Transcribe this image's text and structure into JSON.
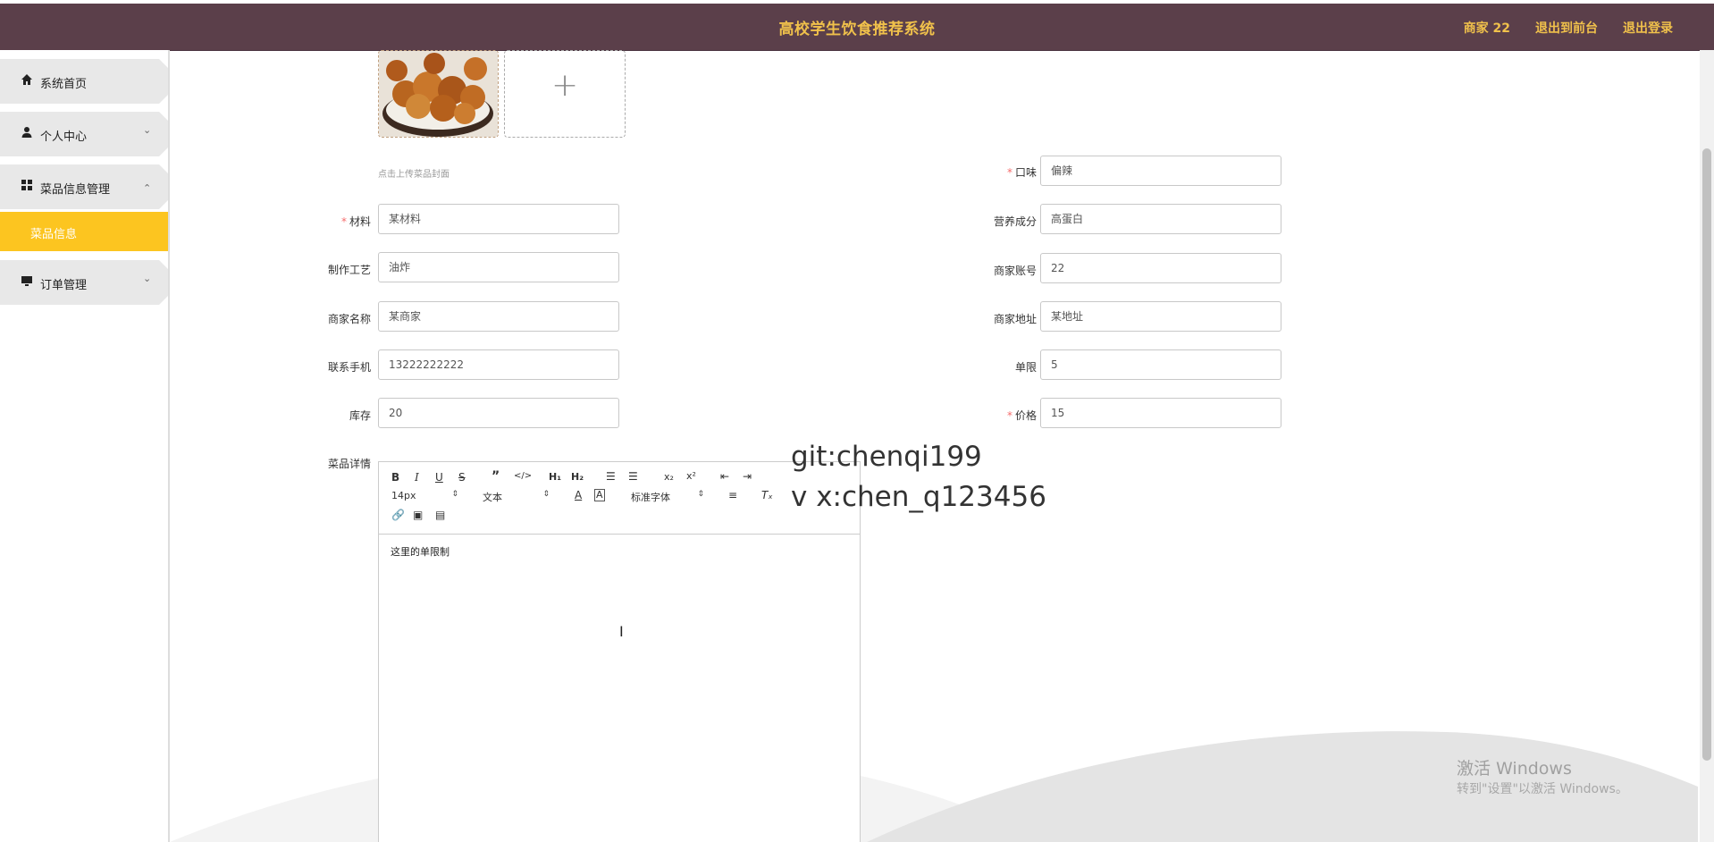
{
  "header": {
    "title": "高校学生饮食推荐系统",
    "links": [
      "商家 22",
      "退出到前台",
      "退出登录"
    ]
  },
  "sidebar": {
    "items": [
      {
        "label": "系统首页",
        "icon": "home-icon"
      },
      {
        "label": "个人中心",
        "icon": "user-icon"
      },
      {
        "label": "菜品信息管理",
        "icon": "grid-icon"
      },
      {
        "label": "订单管理",
        "icon": "monitor-icon"
      }
    ],
    "active_sub": "菜品信息"
  },
  "upload": {
    "tip": "点击上传菜品封面"
  },
  "form": {
    "taste_label": "口味",
    "taste_value": "偏辣",
    "material_label": "材料",
    "material_value": "某材料",
    "nutrition_label": "营养成分",
    "nutrition_value": "高蛋白",
    "craft_label": "制作工艺",
    "craft_value": "油炸",
    "merchant_account_label": "商家账号",
    "merchant_account_value": "22",
    "merchant_name_label": "商家名称",
    "merchant_name_value": "某商家",
    "merchant_address_label": "商家地址",
    "merchant_address_value": "某地址",
    "phone_label": "联系手机",
    "phone_value": "13222222222",
    "limit_label": "单限",
    "limit_value": "5",
    "stock_label": "库存",
    "stock_value": "20",
    "price_label": "价格",
    "price_value": "15",
    "detail_label": "菜品详情"
  },
  "editor": {
    "font_size": "14px",
    "text_type": "文本",
    "font_family": "标准字体",
    "content": "这里的单限制"
  },
  "overlay": {
    "line1": "git:chenqi199",
    "line2": "v x:chen_q123456"
  },
  "windows_activation": {
    "title": "激活 Windows",
    "subtitle": "转到\"设置\"以激活 Windows。"
  },
  "colors": {
    "header_bg": "#5b3f4a",
    "header_text": "#f0c14b",
    "active_menu": "#fcc520",
    "required": "#f56c6c"
  }
}
